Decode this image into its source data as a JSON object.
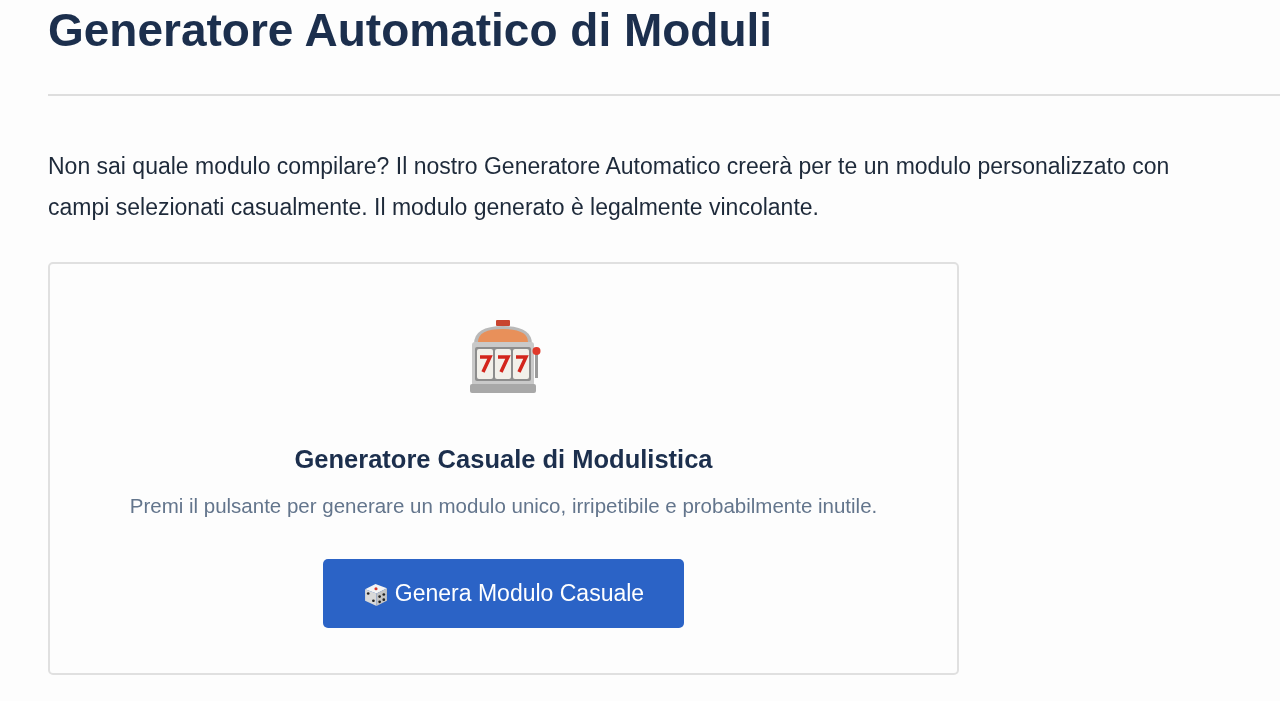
{
  "page": {
    "title": "Generatore Automatico di Moduli",
    "intro": "Non sai quale modulo compilare? Il nostro Generatore Automatico creerà per te un modulo personalizzato con campi selezionati casualmente. Il modulo generato è legalmente vincolante."
  },
  "generator_card": {
    "title": "Generatore Casuale di Modulistica",
    "description": "Premi il pulsante per generare un modulo unico, irripetibile e probabilmente inutile.",
    "button": {
      "label": "Genera Modulo Casuale"
    }
  }
}
